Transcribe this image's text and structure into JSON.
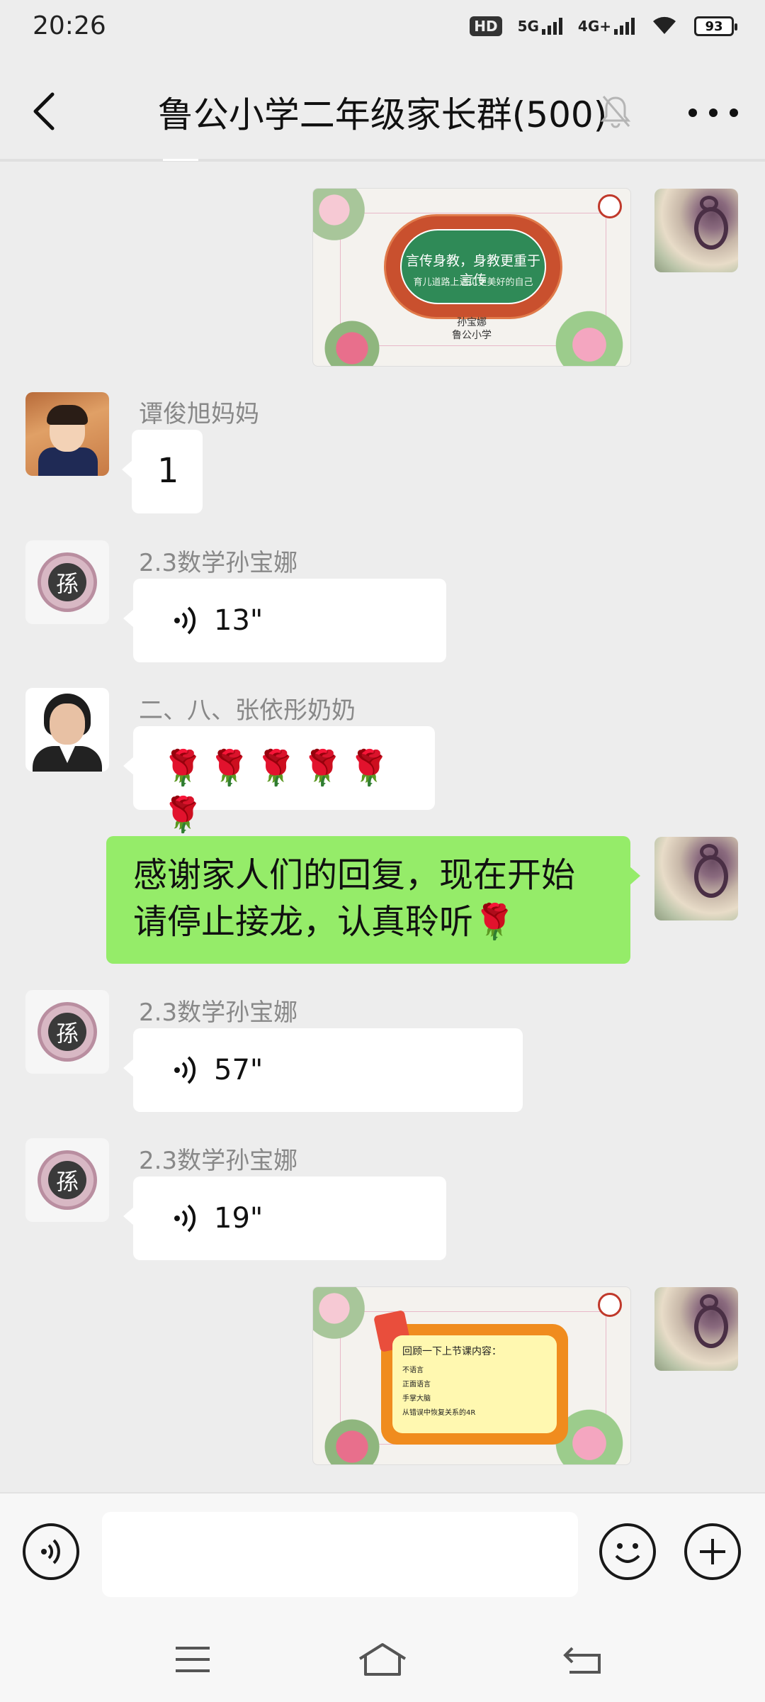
{
  "status_bar": {
    "time": "20:26",
    "hd": "HD",
    "net1": "5G",
    "net2": "4G+",
    "battery": "93"
  },
  "header": {
    "title": "鲁公小学二年级家长群(500)",
    "back_icon": "chevron-left-icon",
    "mute_icon": "bell-off-icon",
    "more_icon": "more-dots-icon"
  },
  "messages": [
    {
      "type": "image",
      "side": "right",
      "image_line1": "言传身教，身教更重于言传",
      "image_line2": "育儿道路上遇见更美好的自己",
      "caption1": "孙宝娜",
      "caption2": "鲁公小学"
    },
    {
      "type": "text",
      "side": "left",
      "sender": "谭俊旭妈妈",
      "text": "1"
    },
    {
      "type": "voice",
      "side": "left",
      "sender": "2.3数学孙宝娜",
      "duration": "13\""
    },
    {
      "type": "text",
      "side": "left",
      "sender": "二、八、张依彤奶奶",
      "text": "🌹🌹🌹🌹🌹🌹"
    },
    {
      "type": "text",
      "side": "right",
      "line1": "感谢家人们的回复，现在开始",
      "line2": "请停止接龙，认真聆听🌹"
    },
    {
      "type": "voice",
      "side": "left",
      "sender": "2.3数学孙宝娜",
      "duration": "57\""
    },
    {
      "type": "voice",
      "side": "left",
      "sender": "2.3数学孙宝娜",
      "duration": "19\""
    },
    {
      "type": "image",
      "side": "right",
      "board_title": "回顾一下上节课内容：",
      "board_items": [
        "不语言",
        "正面语言",
        "手掌大脑",
        "从错误中恢复关系的4R"
      ]
    }
  ],
  "sun_avatar_char": "孫",
  "input_bar": {
    "voice_icon": "voice-toggle-icon",
    "emoji_icon": "emoji-icon",
    "plus_icon": "plus-icon",
    "value": ""
  },
  "nav_bar": {
    "menu_icon": "menu-icon",
    "home_icon": "home-icon",
    "back_icon": "back-icon"
  },
  "colors": {
    "background": "#ededed",
    "bubble_self": "#95ec69",
    "bubble_other": "#ffffff"
  }
}
